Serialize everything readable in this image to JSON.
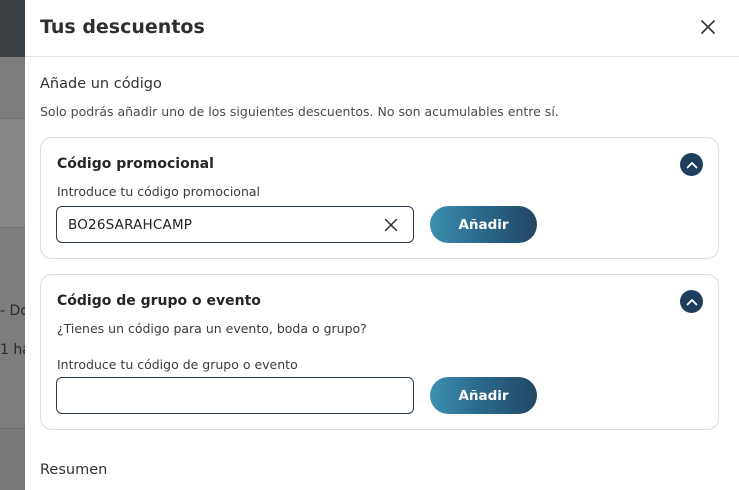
{
  "background": {
    "text_line_1": "- Do",
    "text_line_2": "1 ha"
  },
  "drawer": {
    "title": "Tus descuentos",
    "close_icon": "close-icon"
  },
  "add_code": {
    "title": "Añade un código",
    "description": "Solo podrás añadir uno de los siguientes descuentos. No son acumulables entre sí."
  },
  "promo": {
    "title": "Código promocional",
    "field_label": "Introduce tu código promocional",
    "value": "BO26SARAHCAMP",
    "placeholder": "",
    "button_label": "Añadir",
    "toggle_icon": "chevron-up-icon"
  },
  "group": {
    "title": "Código de grupo o evento",
    "question": "¿Tienes un código para un evento, boda o grupo?",
    "field_label": "Introduce tu código de grupo o evento",
    "value": "",
    "placeholder": "",
    "button_label": "Añadir",
    "toggle_icon": "chevron-up-icon"
  },
  "summary": {
    "title": "Resumen"
  },
  "colors": {
    "accent_dark": "#1f3e5e",
    "button_gradient_start": "#3d8fb1",
    "button_gradient_end": "#214765"
  }
}
